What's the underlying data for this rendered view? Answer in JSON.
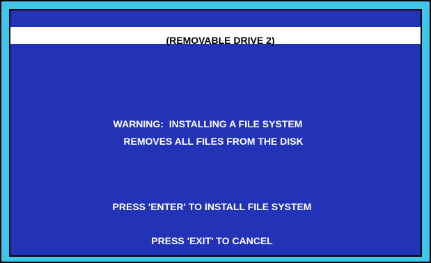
{
  "screen": {
    "title": "(REMOVABLE DRIVE 2)",
    "warning_line_1": "WARNING:  INSTALLING A FILE SYSTEM",
    "warning_line_2": "REMOVES ALL FILES FROM THE DISK",
    "enter_instruction": "PRESS 'ENTER' TO INSTALL FILE SYSTEM",
    "exit_instruction": "PRESS 'EXIT' TO CANCEL"
  },
  "colors": {
    "background": "#2233b8",
    "border": "#3fc6ea",
    "title_bar": "#ffffff",
    "text": "#ffffff"
  }
}
